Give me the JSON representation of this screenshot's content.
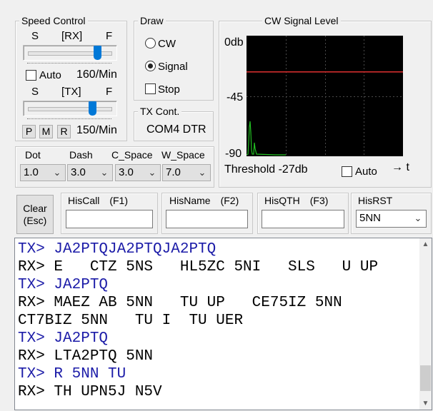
{
  "speed": {
    "title": "Speed Control",
    "rx": {
      "s": "S",
      "label": "[RX]",
      "f": "F",
      "level": 0.85
    },
    "auto_label": "Auto",
    "rx_speed": "160/Min",
    "tx": {
      "s": "S",
      "label": "[TX]",
      "f": "F",
      "level": 0.78
    },
    "buttons": [
      "P",
      "M",
      "R"
    ],
    "tx_speed": "150/Min"
  },
  "draw": {
    "title": "Draw",
    "options": [
      "CW",
      "Signal"
    ],
    "selected": "Signal",
    "stop_label": "Stop"
  },
  "txcont": {
    "title": "TX Cont.",
    "value": "COM4 DTR"
  },
  "signal": {
    "title": "CW Signal Level",
    "y_labels": [
      "0db",
      "-45",
      "-90"
    ],
    "threshold_label": "Threshold -27db",
    "auto_label": "Auto",
    "t_label": "→ t",
    "threshold_db": -27,
    "colors": {
      "bg": "#000000",
      "grid": "#4a4a4a",
      "threshold": "#e03030",
      "trace": "#22c022"
    }
  },
  "timing": {
    "labels": [
      "Dot",
      "Dash",
      "C_Space",
      "W_Space"
    ],
    "values": [
      "1.0",
      "3.0",
      "3.0",
      "7.0"
    ]
  },
  "clear_button": {
    "line1": "Clear",
    "line2": "(Esc)"
  },
  "fields": {
    "hiscall": {
      "label": "HisCall　(F1)",
      "value": ""
    },
    "hisname": {
      "label": "HisName　(F2)",
      "value": ""
    },
    "hisqth": {
      "label": "HisQTH　(F3)",
      "value": ""
    },
    "hisrst": {
      "label": "HisRST",
      "value": "5NN"
    }
  },
  "log": [
    {
      "type": "tx",
      "text": "TX> JA2PTQJA2PTQJA2PTQ"
    },
    {
      "type": "rx",
      "text": "RX> E   CTZ 5NS   HL5ZC 5NI   SLS   U UP"
    },
    {
      "type": "tx",
      "text": "TX> JA2PTQ"
    },
    {
      "type": "rx",
      "text": "RX> MAEZ AB 5NN   TU UP   CE75IZ 5NN"
    },
    {
      "type": "rx",
      "text": "CT7BIZ 5NN   TU I  TU UER"
    },
    {
      "type": "tx",
      "text": "TX> JA2PTQ"
    },
    {
      "type": "rx",
      "text": "RX> LTA2PTQ 5NN"
    },
    {
      "type": "tx",
      "text": "TX> R 5NN TU"
    },
    {
      "type": "rx",
      "text": "RX> TH UPN5J N5V"
    }
  ]
}
